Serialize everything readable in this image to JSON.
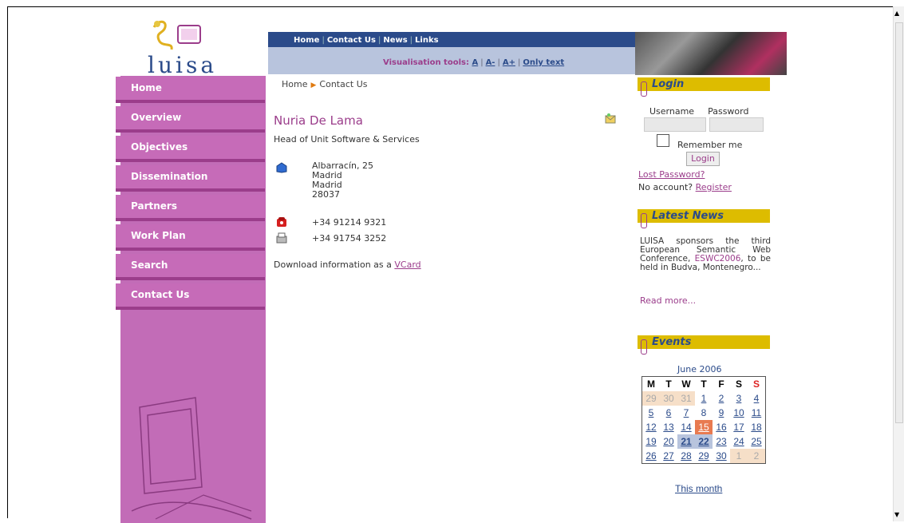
{
  "header": {
    "logo": "luisa",
    "nav": [
      "Home",
      "Contact Us",
      "News",
      "Links"
    ],
    "visualisation_label": "Visualisation tools:",
    "vis_links": [
      "A",
      "A-",
      "A+",
      "Only text"
    ]
  },
  "sidebar": {
    "items": [
      {
        "label": "Home"
      },
      {
        "label": "Overview"
      },
      {
        "label": "Objectives"
      },
      {
        "label": "Dissemination"
      },
      {
        "label": "Partners"
      },
      {
        "label": "Work Plan"
      },
      {
        "label": "Search"
      },
      {
        "label": "Contact Us"
      }
    ]
  },
  "breadcrumb": {
    "home": "Home",
    "current": "Contact Us"
  },
  "contact": {
    "name": "Nuria De Lama",
    "role": "Head of Unit Software & Services",
    "address": [
      "Albarracín, 25",
      "Madrid",
      "Madrid",
      "28037"
    ],
    "tel": "+34 91214 9321",
    "fax": "+34 91754 3252",
    "vcard_text": "Download information as a",
    "vcard_link": "VCard"
  },
  "login": {
    "title": "Login",
    "username_label": "Username",
    "password_label": "Password",
    "remember_label": "Remember me",
    "button": "Login",
    "lost_password": "Lost Password?",
    "no_account": "No account?",
    "register": "Register"
  },
  "news": {
    "title": "Latest News",
    "text_before": "LUISA sponsors the third European Semantic Web Conference,",
    "link": "ESWC2006",
    "text_after": ", to be held in Budva, Montenegro...",
    "read_more": "Read more..."
  },
  "events": {
    "title": "Events",
    "month": "June 2006",
    "weekdays": [
      "M",
      "T",
      "W",
      "T",
      "F",
      "S",
      "S"
    ],
    "weeks": [
      [
        "29",
        "30",
        "31",
        "1",
        "2",
        "3",
        "4"
      ],
      [
        "5",
        "6",
        "7",
        "8",
        "9",
        "10",
        "11"
      ],
      [
        "12",
        "13",
        "14",
        "15",
        "16",
        "17",
        "18"
      ],
      [
        "19",
        "20",
        "21",
        "22",
        "23",
        "24",
        "25"
      ],
      [
        "26",
        "27",
        "28",
        "29",
        "30",
        "1",
        "2"
      ]
    ],
    "this_month": "This month"
  },
  "colors": {
    "brand_blue": "#2b4b8a",
    "brand_purple": "#9b3d8b",
    "menu_pink": "#c66bb8",
    "box_yellow": "#ddbc00"
  }
}
